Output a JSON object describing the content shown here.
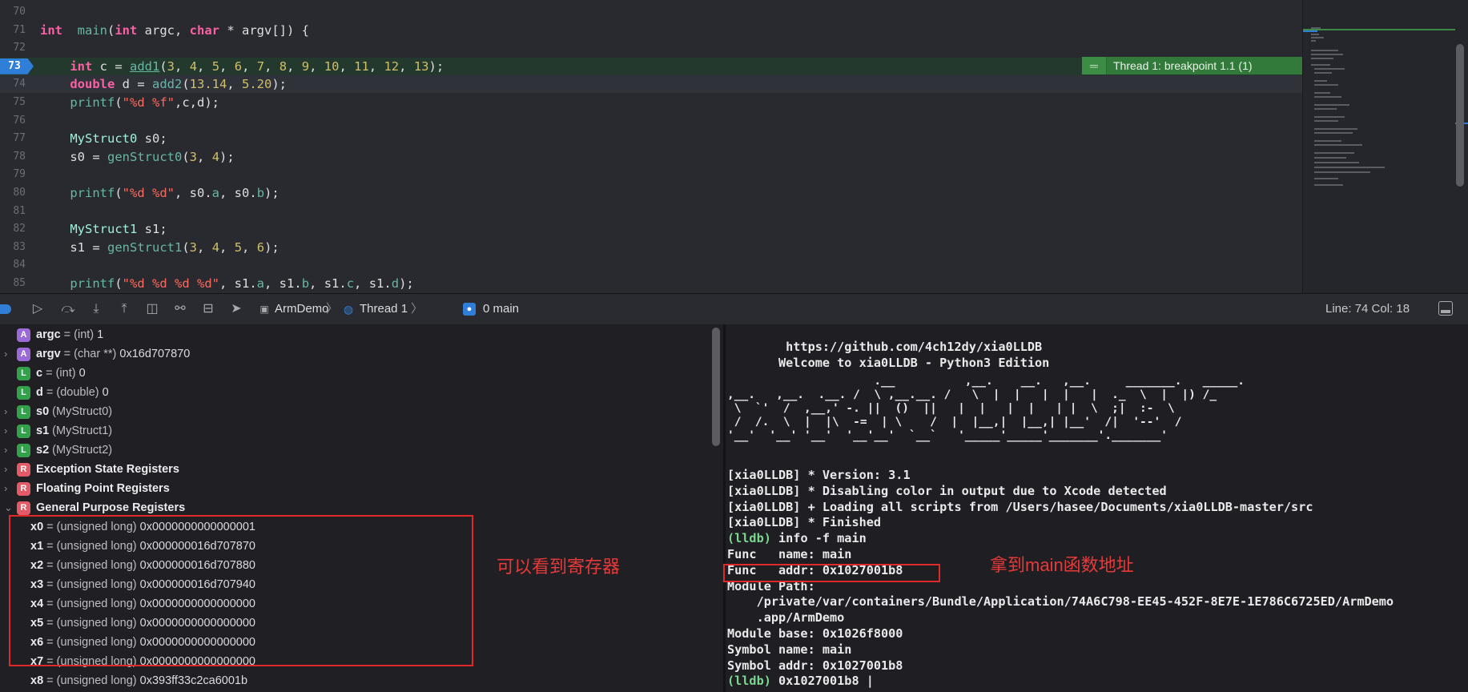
{
  "editor": {
    "lines": [
      {
        "n": "70",
        "segments": []
      },
      {
        "n": "71",
        "segments": [
          [
            "kw",
            "int"
          ],
          [
            "",
            "  "
          ],
          [
            "fn",
            "main"
          ],
          [
            "",
            "("
          ],
          [
            "kw",
            "int"
          ],
          [
            "",
            " argc, "
          ],
          [
            "kw",
            "char"
          ],
          [
            "",
            " * argv[]) {"
          ]
        ]
      },
      {
        "n": "72",
        "segments": []
      },
      {
        "n": "73",
        "segments": [
          [
            "",
            "    "
          ],
          [
            "kw",
            "int"
          ],
          [
            "",
            " c = "
          ],
          [
            "fnu",
            "add1"
          ],
          [
            "",
            "("
          ],
          [
            "num",
            "3"
          ],
          [
            "",
            ", "
          ],
          [
            "num",
            "4"
          ],
          [
            "",
            ", "
          ],
          [
            "num",
            "5"
          ],
          [
            "",
            ", "
          ],
          [
            "num",
            "6"
          ],
          [
            "",
            ", "
          ],
          [
            "num",
            "7"
          ],
          [
            "",
            ", "
          ],
          [
            "num",
            "8"
          ],
          [
            "",
            ", "
          ],
          [
            "num",
            "9"
          ],
          [
            "",
            ", "
          ],
          [
            "num",
            "10"
          ],
          [
            "",
            ", "
          ],
          [
            "num",
            "11"
          ],
          [
            "",
            ", "
          ],
          [
            "num",
            "12"
          ],
          [
            "",
            ", "
          ],
          [
            "num",
            "13"
          ],
          [
            "",
            ");"
          ]
        ]
      },
      {
        "n": "74",
        "segments": [
          [
            "",
            "    "
          ],
          [
            "kw",
            "double"
          ],
          [
            "",
            " d = "
          ],
          [
            "fn",
            "add2"
          ],
          [
            "",
            "("
          ],
          [
            "num",
            "13.14"
          ],
          [
            "",
            ", "
          ],
          [
            "num",
            "5.20"
          ],
          [
            "",
            ");"
          ]
        ]
      },
      {
        "n": "75",
        "segments": [
          [
            "",
            "    "
          ],
          [
            "fn",
            "printf"
          ],
          [
            "",
            "("
          ],
          [
            "str",
            "\"%d %f\""
          ],
          [
            "",
            ",c,d);"
          ]
        ]
      },
      {
        "n": "76",
        "segments": []
      },
      {
        "n": "77",
        "segments": [
          [
            "",
            "    "
          ],
          [
            "usr",
            "MyStruct0"
          ],
          [
            "",
            " s0;"
          ]
        ]
      },
      {
        "n": "78",
        "segments": [
          [
            "",
            "    s0 = "
          ],
          [
            "fn",
            "genStruct0"
          ],
          [
            "",
            "("
          ],
          [
            "num",
            "3"
          ],
          [
            "",
            ", "
          ],
          [
            "num",
            "4"
          ],
          [
            "",
            ");"
          ]
        ]
      },
      {
        "n": "79",
        "segments": []
      },
      {
        "n": "80",
        "segments": [
          [
            "",
            "    "
          ],
          [
            "fn",
            "printf"
          ],
          [
            "",
            "("
          ],
          [
            "str",
            "\"%d %d\""
          ],
          [
            "",
            ", s0."
          ],
          [
            "mem",
            "a"
          ],
          [
            "",
            ", s0."
          ],
          [
            "mem",
            "b"
          ],
          [
            "",
            ");"
          ]
        ]
      },
      {
        "n": "81",
        "segments": []
      },
      {
        "n": "82",
        "segments": [
          [
            "",
            "    "
          ],
          [
            "usr",
            "MyStruct1"
          ],
          [
            "",
            " s1;"
          ]
        ]
      },
      {
        "n": "83",
        "segments": [
          [
            "",
            "    s1 = "
          ],
          [
            "fn",
            "genStruct1"
          ],
          [
            "",
            "("
          ],
          [
            "num",
            "3"
          ],
          [
            "",
            ", "
          ],
          [
            "num",
            "4"
          ],
          [
            "",
            ", "
          ],
          [
            "num",
            "5"
          ],
          [
            "",
            ", "
          ],
          [
            "num",
            "6"
          ],
          [
            "",
            ");"
          ]
        ]
      },
      {
        "n": "84",
        "segments": []
      },
      {
        "n": "85",
        "segments": [
          [
            "",
            "    "
          ],
          [
            "fn",
            "printf"
          ],
          [
            "",
            "("
          ],
          [
            "str",
            "\"%d %d %d %d\""
          ],
          [
            "",
            ", s1."
          ],
          [
            "mem",
            "a"
          ],
          [
            "",
            ", s1."
          ],
          [
            "mem",
            "b"
          ],
          [
            "",
            ", s1."
          ],
          [
            "mem",
            "c"
          ],
          [
            "",
            ", s1."
          ],
          [
            "mem",
            "d"
          ],
          [
            "",
            ");"
          ]
        ]
      }
    ],
    "current_line": "73",
    "breakpoint_label": "Thread 1: breakpoint 1.1 (1)"
  },
  "debugbar": {
    "crumbs": [
      "ArmDemo",
      "Thread 1",
      "0 main"
    ],
    "status": "Line: 74  Col: 18"
  },
  "variables": [
    {
      "chev": "",
      "badge": "A",
      "name": "argc",
      "type": "= (int)",
      "value": "1"
    },
    {
      "chev": "›",
      "badge": "A",
      "name": "argv",
      "type": "= (char **)",
      "value": "0x16d707870"
    },
    {
      "chev": "",
      "badge": "L",
      "name": "c",
      "type": "= (int)",
      "value": "0"
    },
    {
      "chev": "",
      "badge": "L",
      "name": "d",
      "type": "= (double)",
      "value": "0"
    },
    {
      "chev": "›",
      "badge": "L",
      "name": "s0",
      "type": "(MyStruct0)",
      "value": ""
    },
    {
      "chev": "›",
      "badge": "L",
      "name": "s1",
      "type": "(MyStruct1)",
      "value": ""
    },
    {
      "chev": "›",
      "badge": "L",
      "name": "s2",
      "type": "(MyStruct2)",
      "value": ""
    },
    {
      "chev": "›",
      "badge": "R",
      "name": "Exception State Registers",
      "type": "",
      "value": ""
    },
    {
      "chev": "›",
      "badge": "R",
      "name": "Floating Point Registers",
      "type": "",
      "value": ""
    },
    {
      "chev": "⌄",
      "badge": "R",
      "name": "General Purpose Registers",
      "type": "",
      "value": ""
    }
  ],
  "registers": [
    {
      "name": "x0",
      "type": "= (unsigned long)",
      "value": "0x0000000000000001"
    },
    {
      "name": "x1",
      "type": "= (unsigned long)",
      "value": "0x000000016d707870"
    },
    {
      "name": "x2",
      "type": "= (unsigned long)",
      "value": "0x000000016d707880"
    },
    {
      "name": "x3",
      "type": "= (unsigned long)",
      "value": "0x000000016d707940"
    },
    {
      "name": "x4",
      "type": "= (unsigned long)",
      "value": "0x0000000000000000"
    },
    {
      "name": "x5",
      "type": "= (unsigned long)",
      "value": "0x0000000000000000"
    },
    {
      "name": "x6",
      "type": "= (unsigned long)",
      "value": "0x0000000000000000"
    },
    {
      "name": "x7",
      "type": "= (unsigned long)",
      "value": "0x0000000000000000"
    },
    {
      "name": "x8",
      "type": "= (unsigned long)",
      "value": "0x393ff33c2ca6001b"
    }
  ],
  "console": {
    "url": "        https://github.com/4ch12dy/xia0LLDB",
    "welcome": "       Welcome to xia0LLDB - Python3 Edition",
    "banner": [
      "                     .__          ,__.    __.   ,__.     _______.   _____.",
      ",__.   ,__.  .__. /  \\ ,__.__. /   \\  |  |   |  |   |  ._  \\  |  |) /_",
      " \\  `'  /  ,__,' -. ||  ()  ||   |  |   |  |   | |  \\  ;|  :-  \\",
      " /  /.  \\  |  |\\  -=  | \\    /  |  |__,|  |__,| |__'  /|  '--'  /",
      "'__'  '__' '__'  '__'__'  `__`   '_____'_____'_______'._______'"
    ],
    "lines": [
      {
        "text": "[xia0LLDB] * Version: 3.1",
        "prompt": ""
      },
      {
        "text": "[xia0LLDB] * Disabling color in output due to Xcode detected",
        "prompt": ""
      },
      {
        "text": "[xia0LLDB] + Loading all scripts from /Users/hasee/Documents/xia0LLDB-master/src",
        "prompt": ""
      },
      {
        "text": "[xia0LLDB] * Finished",
        "prompt": ""
      },
      {
        "text": " info -f main",
        "prompt": "(lldb)"
      },
      {
        "text": "Func   name: main",
        "prompt": ""
      },
      {
        "text": "Func   addr: 0x1027001b8",
        "prompt": ""
      },
      {
        "text": "Module Path:",
        "prompt": ""
      },
      {
        "text": "    /private/var/containers/Bundle/Application/74A6C798-EE45-452F-8E7E-1E786C6725ED/ArmDemo",
        "prompt": ""
      },
      {
        "text": "    .app/ArmDemo",
        "prompt": ""
      },
      {
        "text": "Module base: 0x1026f8000",
        "prompt": ""
      },
      {
        "text": "Symbol name: main",
        "prompt": ""
      },
      {
        "text": "Symbol addr: 0x1027001b8",
        "prompt": ""
      },
      {
        "text": " 0x1027001b8 |",
        "prompt": "(lldb)"
      }
    ]
  },
  "annotations": {
    "registers_note": "可以看到寄存器",
    "main_addr_note": "拿到main函数地址"
  },
  "colors": {
    "breakpoint": "#2f7ed8",
    "current_line_bg": "#23392d",
    "badge_bg": "#327a3a",
    "annotation_red": "#e02a2a"
  }
}
